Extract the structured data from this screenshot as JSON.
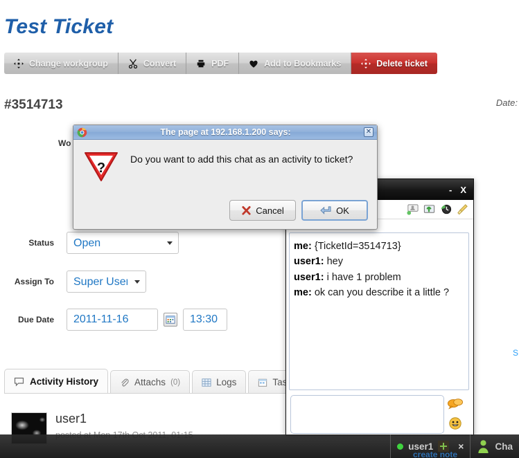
{
  "page": {
    "title": "Test Ticket",
    "ticket_id": "#3514713",
    "date_label": "Date:",
    "workgroup_label_partial": "Wo",
    "save_link_partial": "Sa"
  },
  "toolbar": {
    "buttons": [
      {
        "label": "Change workgroup",
        "icon": "move-arrows-icon",
        "variant": "default"
      },
      {
        "label": "Convert",
        "icon": "scissors-icon",
        "variant": "default"
      },
      {
        "label": "PDF",
        "icon": "printer-icon",
        "variant": "default"
      },
      {
        "label": "Add to Bookmarks",
        "icon": "heart-icon",
        "variant": "default"
      },
      {
        "label": "Delete ticket",
        "icon": "move-arrows-icon",
        "variant": "danger"
      }
    ]
  },
  "form": {
    "status": {
      "label": "Status",
      "value": "Open"
    },
    "assign_to": {
      "label": "Assign To",
      "value": "Super User"
    },
    "due_date": {
      "label": "Due Date",
      "date_value": "2011-11-16",
      "time_value": "13:30",
      "calendar_icon": "calendar-icon"
    }
  },
  "tabs": [
    {
      "label": "Activity History",
      "count": "",
      "icon": "comment-icon",
      "active": true
    },
    {
      "label": "Attachs",
      "count": "(0)",
      "icon": "paperclip-icon",
      "active": false
    },
    {
      "label": "Logs",
      "count": "",
      "icon": "grid-icon",
      "active": false
    },
    {
      "label": "Tas",
      "count": "",
      "icon": "calendar-icon",
      "active": false
    }
  ],
  "activity": {
    "user": "user1",
    "posted": "posted at Mon 17th Oct 2011, 01:15"
  },
  "dialog": {
    "title": "The page at 192.168.1.200 says:",
    "message": "Do you want to add this chat as an activity to ticket?",
    "browser_icon": "chrome-icon",
    "warning_icon": "question-warning-icon",
    "close_icon": "close-icon",
    "cancel_button": {
      "label": "Cancel",
      "accel": "C",
      "icon": "x-mark-icon"
    },
    "ok_button": {
      "label": "OK",
      "accel": "O",
      "icon": "enter-arrow-icon"
    }
  },
  "chat_window": {
    "minimize_label": "-",
    "close_label": "X",
    "toolbar_icons": [
      "user-card-icon",
      "upload-image-icon",
      "history-clock-icon",
      "broom-clear-icon"
    ],
    "messages": [
      {
        "sender": "me:",
        "text": "{TicketId=3514713}"
      },
      {
        "sender": "user1:",
        "text": "hey"
      },
      {
        "sender": "user1:",
        "text": "i have 1 problem"
      },
      {
        "sender": "me:",
        "text": "ok can you describe it a little ?"
      }
    ],
    "input_value": "",
    "input_placeholder": "",
    "side_icons": [
      "chat-bubbles-icon",
      "smiley-icon"
    ]
  },
  "taskbar": {
    "user_tab": {
      "label": "user1",
      "status": "online",
      "close_label": "×",
      "status_color": "#3fd23f"
    },
    "chat_tab": {
      "label": "Cha",
      "icon": "person-icon"
    },
    "create_note_label": "create note",
    "plus_icon": "plus-icon"
  },
  "colors": {
    "title_blue": "#1f5fa9",
    "field_blue": "#1f77c4",
    "danger_red": "#c9302c",
    "online_green": "#3fd23f",
    "dialog_title_blue": "#8fb0da"
  }
}
